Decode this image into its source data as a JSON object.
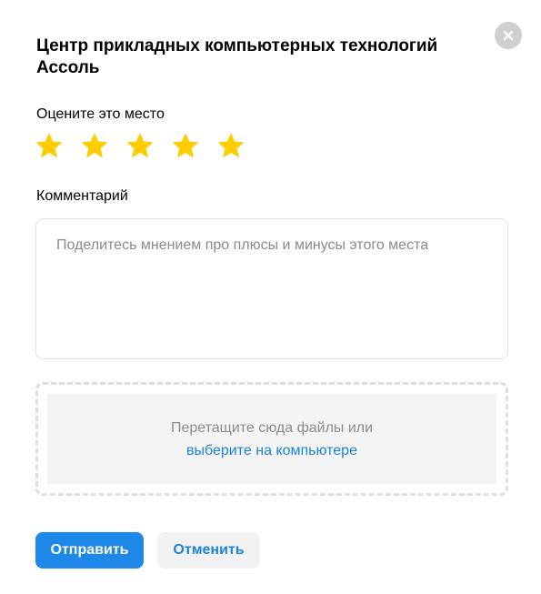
{
  "modal": {
    "title": "Центр прикладных компьютерных технологий Ассоль"
  },
  "rating": {
    "label": "Оцените это место",
    "max_stars": 5,
    "star_color": "#FFCC00"
  },
  "comment": {
    "label": "Комментарий",
    "placeholder": "Поделитесь мнением про плюсы и минусы этого места",
    "value": ""
  },
  "upload": {
    "hint": "Перетащите сюда файлы или",
    "link": "выберите на компьютере"
  },
  "actions": {
    "submit_label": "Отправить",
    "cancel_label": "Отменить"
  },
  "colors": {
    "primary": "#1E88E8",
    "link": "#1A84D8",
    "close_bg": "#CFCFCF"
  },
  "icons": {
    "close": "close-icon",
    "star": "star-icon"
  }
}
